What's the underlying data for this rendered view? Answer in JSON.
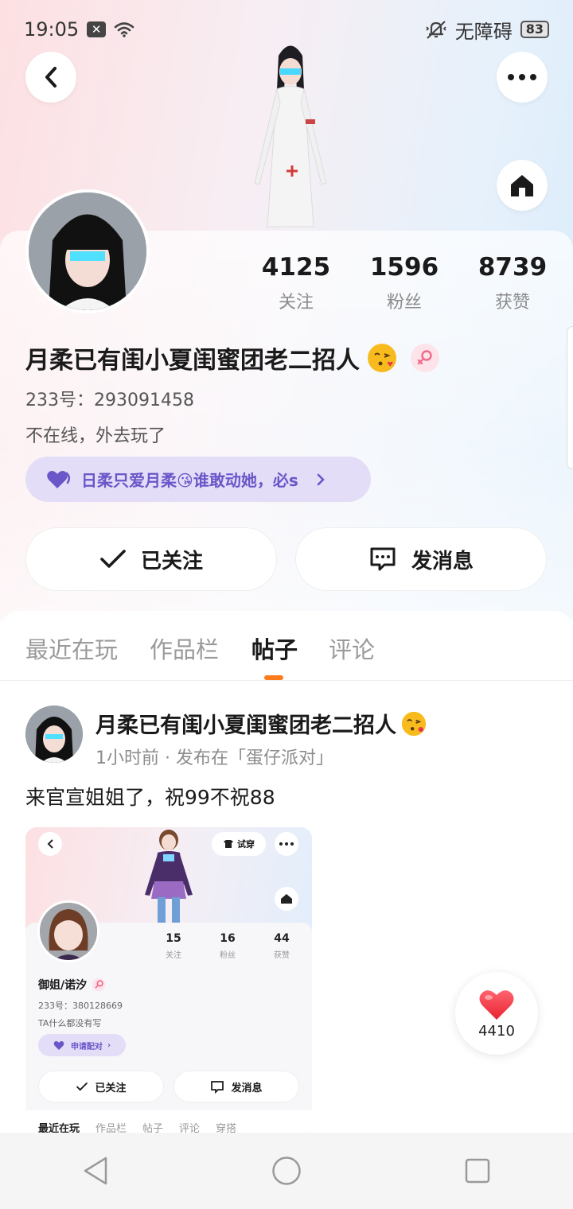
{
  "status": {
    "time": "19:05",
    "accessibility": "无障碍",
    "battery": "83"
  },
  "profile": {
    "stats": [
      {
        "value": "4125",
        "label": "关注"
      },
      {
        "value": "1596",
        "label": "粉丝"
      },
      {
        "value": "8739",
        "label": "获赞"
      }
    ],
    "nickname": "月柔已有闺小夏闺蜜团老二招人",
    "uid": "233号：293091458",
    "bio": "不在线，外去玩了",
    "relation_pill": "日柔只爱月柔😘谁敢动她，必s",
    "follow_label": "已关注",
    "message_label": "发消息"
  },
  "tabs": [
    "最近在玩",
    "作品栏",
    "帖子",
    "评论"
  ],
  "active_tab": "帖子",
  "post": {
    "author": "月柔已有闺小夏闺蜜团老二招人",
    "meta": "1小时前 · 发布在「蛋仔派对」",
    "text": "来官宣姐姐了，祝99不祝88",
    "likes": "4410",
    "screenshot": {
      "try_on_label": "试穿",
      "stats": [
        {
          "value": "15",
          "label": "关注"
        },
        {
          "value": "16",
          "label": "粉丝"
        },
        {
          "value": "44",
          "label": "获赞"
        }
      ],
      "name": "御姐/诺汐",
      "uid": "233号：380128669",
      "bio": "TA什么都没有写",
      "pill": "申请配对",
      "follow_label": "已关注",
      "message_label": "发消息",
      "tabs": [
        "最近在玩",
        "作品栏",
        "帖子",
        "评论",
        "穿搭"
      ]
    }
  },
  "colors": {
    "accent_orange": "#ff7a1a",
    "pill_purple": "#6a56c8",
    "like_red": "#f53b4a"
  }
}
